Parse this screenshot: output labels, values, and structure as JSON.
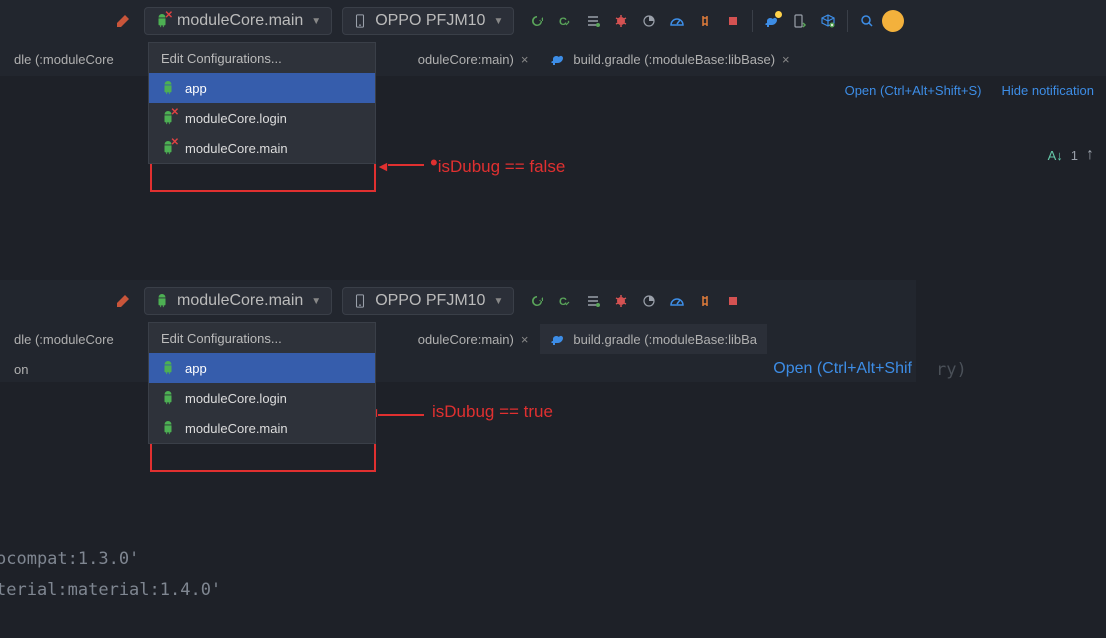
{
  "panel1": {
    "toolbar": {
      "run_config": "moduleCore.main",
      "device": "OPPO PFJM10"
    },
    "tabs": {
      "t1_prefix": "dle (:moduleCore",
      "t2": "oduleCore:main)",
      "t3": "build.gradle (:moduleBase:libBase)"
    },
    "links": {
      "open": "Open (Ctrl+Alt+Shift+S)",
      "hide": "Hide notification"
    },
    "menu": {
      "header": "Edit Configurations...",
      "i1": "app",
      "i2": "moduleCore.login",
      "i3": "moduleCore.main"
    },
    "annotation": "isDubug == false",
    "marks": {
      "az": "1"
    }
  },
  "panel2": {
    "toolbar": {
      "run_config": "moduleCore.main",
      "device": "OPPO PFJM10"
    },
    "tabs": {
      "t1_prefix": "dle (:moduleCore",
      "t2": "oduleCore:main)",
      "t3": "build.gradle (:moduleBase:libBa",
      "t1_suffix_on": "on"
    },
    "links": {
      "open": "Open (Ctrl+Alt+Shif"
    },
    "menu": {
      "header": "Edit Configurations...",
      "i1": "app",
      "i2": "moduleCore.login",
      "i3": "moduleCore.main"
    },
    "annotation": "isDubug == true",
    "side_text": "ry)"
  },
  "code": {
    "l1": "ocompat:1.3.0'",
    "l2": "terial:material:1.4.0'"
  }
}
